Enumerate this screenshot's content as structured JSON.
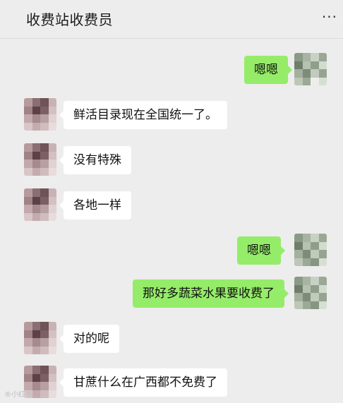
{
  "header": {
    "title": "收费站收费员",
    "more_label": "···"
  },
  "colors": {
    "background": "#ededed",
    "incoming_bubble": "#ffffff",
    "outgoing_bubble": "#95ec69"
  },
  "messages": [
    {
      "from": "self",
      "text": "嗯嗯"
    },
    {
      "from": "other",
      "text": "鲜活目录现在全国统一了。"
    },
    {
      "from": "other",
      "text": "没有特殊"
    },
    {
      "from": "other",
      "text": "各地一样"
    },
    {
      "from": "self",
      "text": "嗯嗯"
    },
    {
      "from": "self",
      "text": "那好多蔬菜水果要收费了"
    },
    {
      "from": "other",
      "text": "对的呢"
    },
    {
      "from": "other",
      "text": "甘蔗什么在广西都不免费了"
    }
  ],
  "watermark": "®小红书"
}
